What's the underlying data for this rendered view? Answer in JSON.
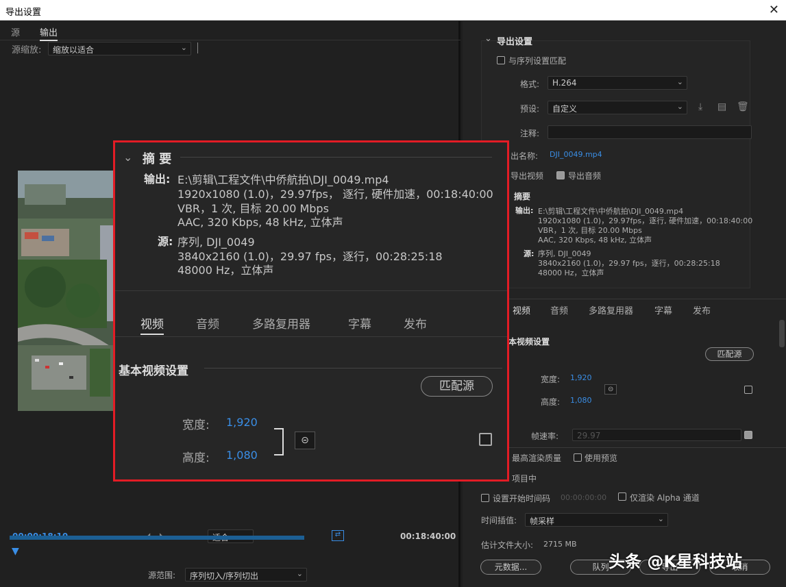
{
  "window": {
    "title": "导出设置",
    "close": "✕"
  },
  "left": {
    "tabs": [
      "源",
      "输出"
    ],
    "source_scale_label": "源缩放:",
    "source_scale_value": "缩放以适合",
    "timecode_current": "00:00:18:10",
    "timecode_end": "00:18:40:00",
    "fit_value": "适合",
    "source_range_label": "源范围:",
    "source_range_value": "序列切入/序列切出"
  },
  "right": {
    "export_settings_title": "导出设置",
    "match_sequence_label": "与序列设置匹配",
    "format_label": "格式:",
    "format_value": "H.264",
    "preset_label": "预设:",
    "preset_value": "自定义",
    "comment_label": "注释:",
    "output_name_label": "出名称:",
    "output_name_value": "DJI_0049.mp4",
    "export_video_label": "导出视频",
    "export_audio_label": "导出音频",
    "summary_title": "摘要",
    "summary_output_label": "输出:",
    "summary_output_lines": [
      "E:\\剪辑\\工程文件\\中侨航拍\\DJI_0049.mp4",
      "1920x1080 (1.0)，29.97fps，逐行, 硬件加速，00:18:40:00",
      "VBR，1 次, 目标 20.00 Mbps",
      "AAC, 320 Kbps, 48  kHz, 立体声"
    ],
    "summary_source_label": "源:",
    "summary_source_lines": [
      "序列, DJI_0049",
      "3840x2160 (1.0)，29.97 fps，逐行，00:28:25:18",
      "48000 Hz，立体声"
    ],
    "tabs": [
      "视频",
      "音频",
      "多路复用器",
      "字幕",
      "发布"
    ],
    "basic_video_title": "本视频设置",
    "match_source_btn": "匹配源",
    "width_label": "宽度:",
    "width_value": "1,920",
    "height_label": "高度:",
    "height_value": "1,080",
    "framerate_label": "帧速率:",
    "framerate_value": "29.97",
    "max_render_label": "最高渲染质量",
    "use_preview_label": "使用预览",
    "project_label": "项目中",
    "set_start_tc_label": "设置开始时间码",
    "start_tc_value": "00:00:00:00",
    "alpha_only_label": "仅渲染 Alpha 通道",
    "time_interp_label": "时间插值:",
    "time_interp_value": "帧采样",
    "est_size_label": "估计文件大小:",
    "est_size_value": "2715 MB",
    "metadata_btn": "元数据...",
    "queue_btn": "队列",
    "export_btn": "导出",
    "cancel_btn": "取消"
  },
  "callout": {
    "summary_title": "摘 要",
    "output_label": "输出:",
    "output_lines": [
      "E:\\剪辑\\工程文件\\中侨航拍\\DJI_0049.mp4",
      "1920x1080 (1.0)，29.97fps， 逐行, 硬件加速，00:18:40:00",
      "VBR，1 次, 目标 20.00 Mbps",
      "AAC, 320 Kbps, 48  kHz, 立体声"
    ],
    "source_label": "源:",
    "source_lines": [
      "序列, DJI_0049",
      "3840x2160 (1.0)，29.97 fps，逐行，00:28:25:18",
      "48000 Hz，立体声"
    ],
    "tabs": [
      "视频",
      "音频",
      "多路复用器",
      "字幕",
      "发布"
    ],
    "basic_video_title": "基本视频设置",
    "match_source_btn": "匹配源",
    "width_label": "宽度:",
    "width_value": "1,920",
    "height_label": "高度:",
    "height_value": "1,080"
  },
  "watermark": "头条 @K星科技站"
}
